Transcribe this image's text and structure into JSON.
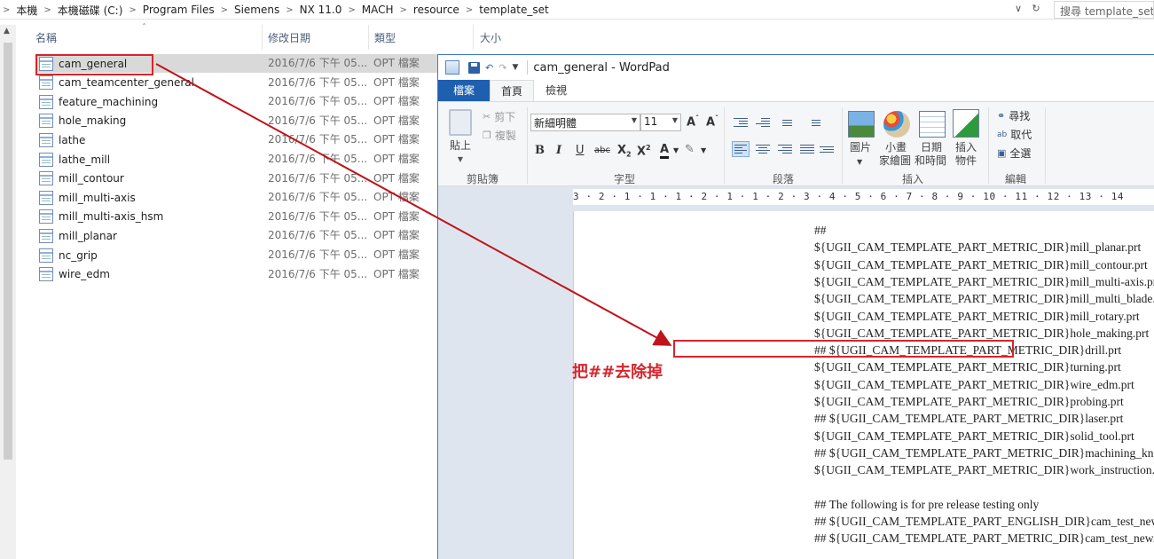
{
  "explorer": {
    "breadcrumbs": [
      "本機",
      "本機磁碟 (C:)",
      "Program Files",
      "Siemens",
      "NX 11.0",
      "MACH",
      "resource",
      "template_set"
    ],
    "search_placeholder": "搜尋 template_set",
    "columns": {
      "name": "名稱",
      "date": "修改日期",
      "type": "類型",
      "size": "大小"
    },
    "files": [
      {
        "name": "cam_general",
        "date": "2016/7/6 下午 05...",
        "type": "OPT 檔案",
        "selected": true
      },
      {
        "name": "cam_teamcenter_general",
        "date": "2016/7/6 下午 05...",
        "type": "OPT 檔案"
      },
      {
        "name": "feature_machining",
        "date": "2016/7/6 下午 05...",
        "type": "OPT 檔案"
      },
      {
        "name": "hole_making",
        "date": "2016/7/6 下午 05...",
        "type": "OPT 檔案"
      },
      {
        "name": "lathe",
        "date": "2016/7/6 下午 05...",
        "type": "OPT 檔案"
      },
      {
        "name": "lathe_mill",
        "date": "2016/7/6 下午 05...",
        "type": "OPT 檔案"
      },
      {
        "name": "mill_contour",
        "date": "2016/7/6 下午 05...",
        "type": "OPT 檔案"
      },
      {
        "name": "mill_multi-axis",
        "date": "2016/7/6 下午 05...",
        "type": "OPT 檔案"
      },
      {
        "name": "mill_multi-axis_hsm",
        "date": "2016/7/6 下午 05...",
        "type": "OPT 檔案"
      },
      {
        "name": "mill_planar",
        "date": "2016/7/6 下午 05...",
        "type": "OPT 檔案"
      },
      {
        "name": "nc_grip",
        "date": "2016/7/6 下午 05...",
        "type": "OPT 檔案"
      },
      {
        "name": "wire_edm",
        "date": "2016/7/6 下午 05...",
        "type": "OPT 檔案"
      }
    ]
  },
  "wordpad": {
    "title": "cam_general - WordPad",
    "tabs": {
      "file": "檔案",
      "home": "首頁",
      "view": "檢視"
    },
    "clipboard": {
      "paste": "貼上",
      "cut": "剪下",
      "copy": "複製",
      "label": "剪貼簿"
    },
    "font": {
      "family": "新細明體",
      "size": "11",
      "label": "字型"
    },
    "paragraph": {
      "label": "段落"
    },
    "insert": {
      "picture": "圖片",
      "paint_1": "小畫",
      "paint_2": "家繪圖",
      "datetime_1": "日期",
      "datetime_2": "和時間",
      "object_1": "插入",
      "object_2": "物件",
      "label": "插入"
    },
    "editing": {
      "find": "尋找",
      "replace": "取代",
      "select_all": "全選",
      "label": "編輯"
    },
    "ruler": "3 · 2 · 1 · 1 · 1 · 2 · 1 · 1 · 2 · 3 · 4 · 5 · 6 · 7 · 8 · 9 · 10 · 11 · 12 · 13 · 14",
    "document_lines": [
      "##",
      "${UGII_CAM_TEMPLATE_PART_METRIC_DIR}mill_planar.prt",
      "${UGII_CAM_TEMPLATE_PART_METRIC_DIR}mill_contour.prt",
      "${UGII_CAM_TEMPLATE_PART_METRIC_DIR}mill_multi-axis.prt",
      "${UGII_CAM_TEMPLATE_PART_METRIC_DIR}mill_multi_blade.prt",
      "${UGII_CAM_TEMPLATE_PART_METRIC_DIR}mill_rotary.prt",
      "${UGII_CAM_TEMPLATE_PART_METRIC_DIR}hole_making.prt",
      "## ${UGII_CAM_TEMPLATE_PART_METRIC_DIR}drill.prt",
      "${UGII_CAM_TEMPLATE_PART_METRIC_DIR}turning.prt",
      "${UGII_CAM_TEMPLATE_PART_METRIC_DIR}wire_edm.prt",
      "${UGII_CAM_TEMPLATE_PART_METRIC_DIR}probing.prt",
      "## ${UGII_CAM_TEMPLATE_PART_METRIC_DIR}laser.prt",
      "${UGII_CAM_TEMPLATE_PART_METRIC_DIR}solid_tool.prt",
      "## ${UGII_CAM_TEMPLATE_PART_METRIC_DIR}machining_knowledge.prt",
      "${UGII_CAM_TEMPLATE_PART_METRIC_DIR}work_instruction.prt",
      "",
      "## The following is for pre release testing only",
      "## ${UGII_CAM_TEMPLATE_PART_ENGLISH_DIR}cam_test_new.prt",
      "## ${UGII_CAM_TEMPLATE_PART_METRIC_DIR}cam_test_new.prt"
    ]
  },
  "annotation": {
    "text": "把##去除掉",
    "color": "#d6252c"
  }
}
